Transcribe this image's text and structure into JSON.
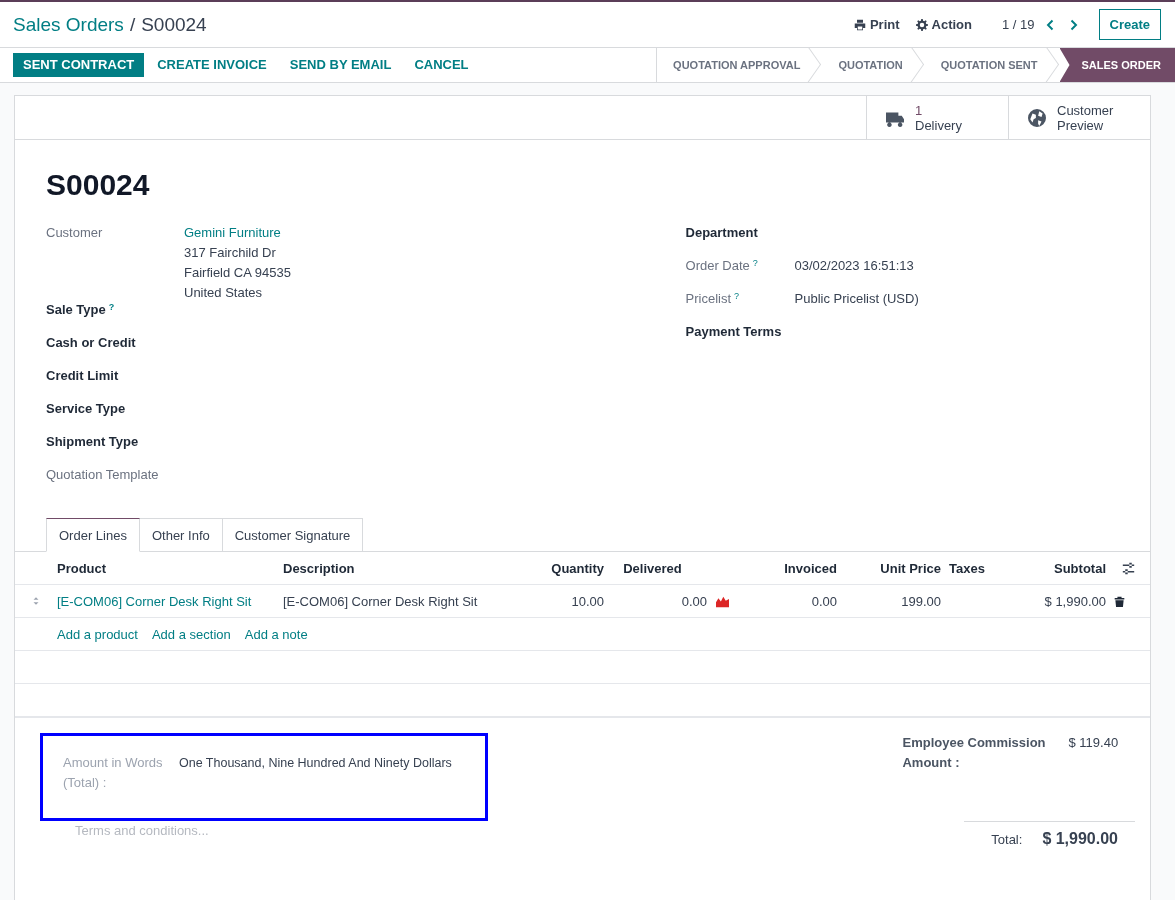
{
  "breadcrumb": {
    "parent": "Sales Orders",
    "separator": "/",
    "current": "S00024"
  },
  "actions": [
    {
      "kind": "print",
      "label": "Print"
    },
    {
      "kind": "gear",
      "label": "Action"
    }
  ],
  "pager": "1 / 19",
  "create_button": "Create",
  "buttons": [
    {
      "label": "SENT CONTRACT",
      "primary": true
    },
    {
      "label": "CREATE INVOICE",
      "primary": false
    },
    {
      "label": "SEND BY EMAIL",
      "primary": false
    },
    {
      "label": "CANCEL",
      "primary": false
    }
  ],
  "stages": [
    {
      "label": "QUOTATION APPROVAL",
      "selected": false
    },
    {
      "label": "QUOTATION",
      "selected": false
    },
    {
      "label": "QUOTATION SENT",
      "selected": false
    },
    {
      "label": "SALES ORDER",
      "selected": true
    }
  ],
  "smart_buttons": [
    {
      "kind": "truck",
      "count": "1",
      "label": "Delivery"
    },
    {
      "kind": "globe",
      "label": "Customer Preview"
    }
  ],
  "order_name": "S00024",
  "left_fields": [
    {
      "label": "Customer",
      "required": false,
      "link": "Gemini Furniture",
      "lines": [
        "317 Fairchild Dr",
        "Fairfield CA 94535",
        "United States"
      ]
    },
    {
      "label": "Sale Type",
      "required": true,
      "help": "?"
    },
    {
      "label": "Cash or Credit",
      "required": true
    },
    {
      "label": "Credit Limit",
      "required": true
    },
    {
      "label": "Service Type",
      "required": true
    },
    {
      "label": "Shipment Type",
      "required": true
    },
    {
      "label": "Quotation Template",
      "required": false
    }
  ],
  "right_fields": [
    {
      "label": "Department",
      "required": true
    },
    {
      "label": "Order Date",
      "required": false,
      "help": "?",
      "value": "03/02/2023 16:51:13"
    },
    {
      "label": "Pricelist",
      "required": false,
      "help": "?",
      "value": "Public Pricelist (USD)"
    },
    {
      "label": "Payment Terms",
      "required": true
    }
  ],
  "tabs": [
    {
      "label": "Order Lines",
      "selected": true
    },
    {
      "label": "Other Info",
      "selected": false
    },
    {
      "label": "Customer Signature",
      "selected": false
    }
  ],
  "table": {
    "columns": [
      "Product",
      "Description",
      "Quantity",
      "Delivered",
      "Invoiced",
      "Unit Price",
      "Taxes",
      "Subtotal"
    ],
    "rows": [
      {
        "product": "[E-COM06] Corner Desk Right Sit",
        "description": "[E-COM06] Corner Desk Right Sit",
        "quantity": "10.00",
        "delivered": "0.00",
        "invoiced": "0.00",
        "unit_price": "199.00",
        "subtotal": "$ 1,990.00"
      }
    ]
  },
  "add_links": [
    "Add a product",
    "Add a section",
    "Add a note"
  ],
  "amount_in_words": {
    "label": "Amount in Words (Total) :",
    "value": "One Thousand, Nine Hundred And Ninety Dollars",
    "highlighted": true
  },
  "terms_placeholder": "Terms and conditions...",
  "commission": {
    "label": "Employee Commission Amount :",
    "value": "$ 119.40"
  },
  "total": {
    "label": "Total:",
    "value": "$ 1,990.00"
  }
}
